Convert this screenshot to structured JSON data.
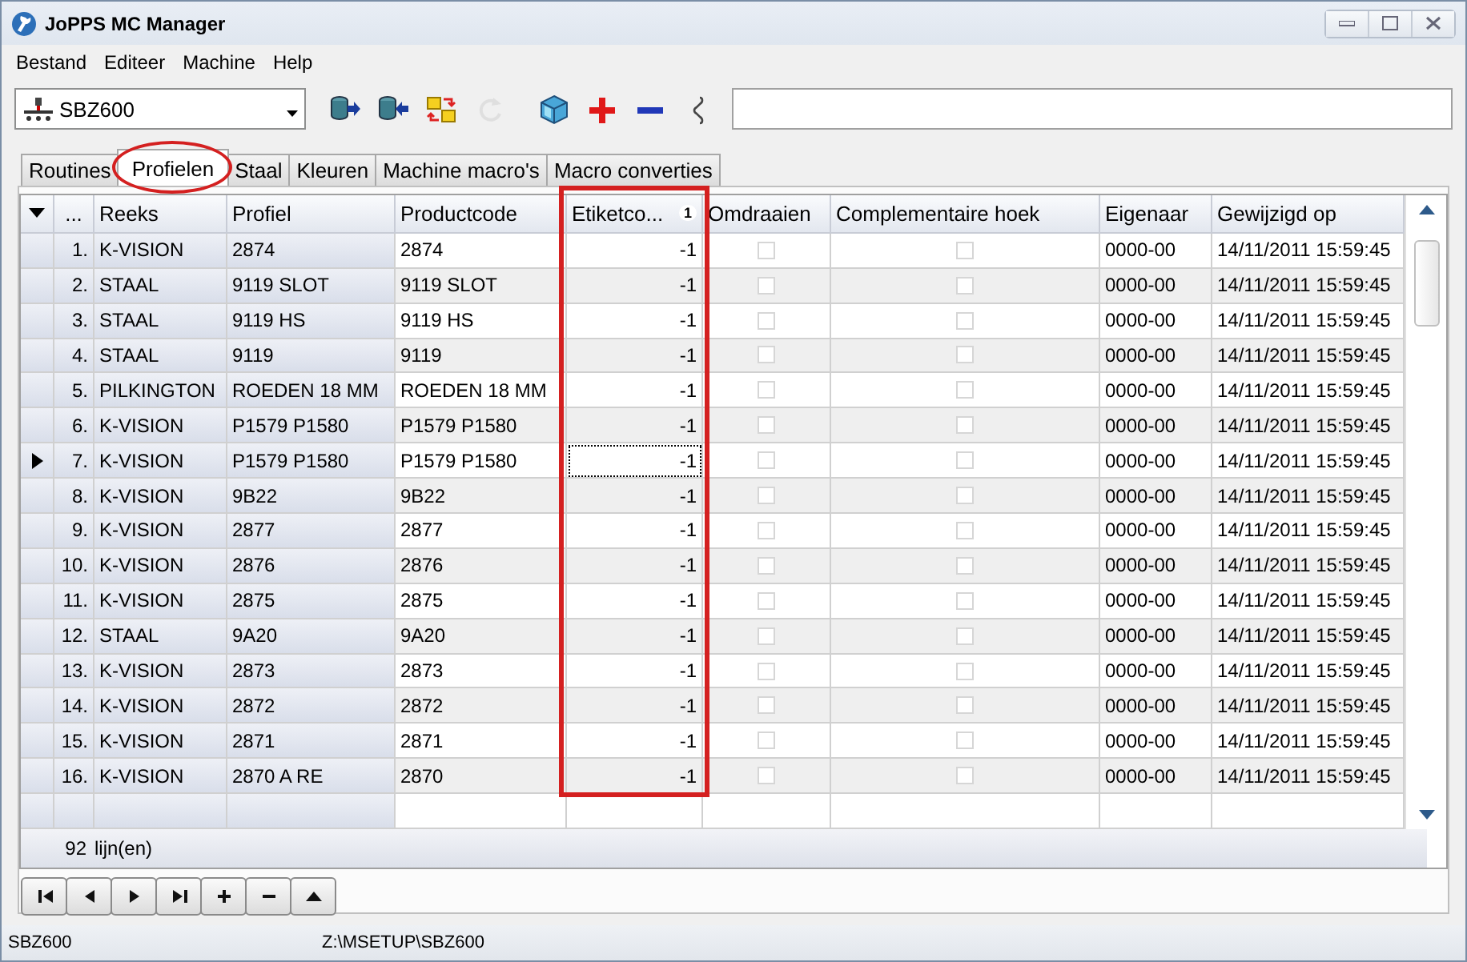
{
  "window": {
    "title": "JoPPS MC Manager"
  },
  "menu": [
    "Bestand",
    "Editeer",
    "Machine",
    "Help"
  ],
  "machine_select": {
    "value": "SBZ600"
  },
  "toolbar": [
    {
      "kind": "db-right",
      "disabled": false
    },
    {
      "kind": "db-left",
      "disabled": false
    },
    {
      "kind": "folders",
      "disabled": false
    },
    {
      "kind": "refresh",
      "disabled": true
    },
    {
      "kind": "cube",
      "disabled": false
    },
    {
      "kind": "plus",
      "disabled": false
    },
    {
      "kind": "minus",
      "disabled": false
    },
    {
      "kind": "link",
      "disabled": false
    }
  ],
  "tabs": [
    {
      "label": "Routines",
      "selected": false,
      "circled": false
    },
    {
      "label": "Profielen",
      "selected": true,
      "circled": true
    },
    {
      "label": "Staal",
      "selected": false,
      "circled": false
    },
    {
      "label": "Kleuren",
      "selected": false,
      "circled": false
    },
    {
      "label": "Machine macro's",
      "selected": false,
      "circled": false
    },
    {
      "label": "Macro converties",
      "selected": false,
      "circled": false
    }
  ],
  "table": {
    "columns": [
      {
        "label": "...",
        "boxed": false
      },
      {
        "label": "Reeks",
        "boxed": false
      },
      {
        "label": "Profiel",
        "boxed": false
      },
      {
        "label": "Productcode",
        "boxed": false
      },
      {
        "label": "Etiketco...",
        "boxed": true,
        "sort_badge": "1"
      },
      {
        "label": "Omdraaien",
        "boxed": false
      },
      {
        "label": "Complementaire hoek",
        "boxed": false
      },
      {
        "label": "Eigenaar",
        "boxed": false
      },
      {
        "label": "Gewijzigd op",
        "boxed": false
      }
    ],
    "rows": [
      {
        "num": "1.",
        "reeks": "K-VISION",
        "profiel": "2874",
        "productcode": "2874",
        "etiketcode": "-1",
        "omdraaien": false,
        "complementaire_hoek": false,
        "eigenaar": "0000-00",
        "gewijzigd_op": "14/11/2011 15:59:45",
        "selected": false
      },
      {
        "num": "2.",
        "reeks": "STAAL",
        "profiel": "9119 SLOT",
        "productcode": "9119 SLOT",
        "etiketcode": "-1",
        "omdraaien": false,
        "complementaire_hoek": false,
        "eigenaar": "0000-00",
        "gewijzigd_op": "14/11/2011 15:59:45",
        "selected": false
      },
      {
        "num": "3.",
        "reeks": "STAAL",
        "profiel": "9119 HS",
        "productcode": "9119 HS",
        "etiketcode": "-1",
        "omdraaien": false,
        "complementaire_hoek": false,
        "eigenaar": "0000-00",
        "gewijzigd_op": "14/11/2011 15:59:45",
        "selected": false
      },
      {
        "num": "4.",
        "reeks": "STAAL",
        "profiel": "9119",
        "productcode": "9119",
        "etiketcode": "-1",
        "omdraaien": false,
        "complementaire_hoek": false,
        "eigenaar": "0000-00",
        "gewijzigd_op": "14/11/2011 15:59:45",
        "selected": false
      },
      {
        "num": "5.",
        "reeks": "PILKINGTON",
        "profiel": "ROEDEN 18 MM",
        "productcode": "ROEDEN 18 MM",
        "etiketcode": "-1",
        "omdraaien": false,
        "complementaire_hoek": false,
        "eigenaar": "0000-00",
        "gewijzigd_op": "14/11/2011 15:59:45",
        "selected": false
      },
      {
        "num": "6.",
        "reeks": "K-VISION",
        "profiel": "P1579 P1580",
        "productcode": "P1579 P1580",
        "etiketcode": "-1",
        "omdraaien": false,
        "complementaire_hoek": false,
        "eigenaar": "0000-00",
        "gewijzigd_op": "14/11/2011 15:59:45",
        "selected": false
      },
      {
        "num": "7.",
        "reeks": "K-VISION",
        "profiel": "P1579 P1580",
        "productcode": "P1579 P1580",
        "etiketcode": "-1",
        "omdraaien": false,
        "complementaire_hoek": false,
        "eigenaar": "0000-00",
        "gewijzigd_op": "14/11/2011 15:59:45",
        "selected": true
      },
      {
        "num": "8.",
        "reeks": "K-VISION",
        "profiel": "9B22",
        "productcode": "9B22",
        "etiketcode": "-1",
        "omdraaien": false,
        "complementaire_hoek": false,
        "eigenaar": "0000-00",
        "gewijzigd_op": "14/11/2011 15:59:45",
        "selected": false
      },
      {
        "num": "9.",
        "reeks": "K-VISION",
        "profiel": "2877",
        "productcode": "2877",
        "etiketcode": "-1",
        "omdraaien": false,
        "complementaire_hoek": false,
        "eigenaar": "0000-00",
        "gewijzigd_op": "14/11/2011 15:59:45",
        "selected": false
      },
      {
        "num": "10.",
        "reeks": "K-VISION",
        "profiel": "2876",
        "productcode": "2876",
        "etiketcode": "-1",
        "omdraaien": false,
        "complementaire_hoek": false,
        "eigenaar": "0000-00",
        "gewijzigd_op": "14/11/2011 15:59:45",
        "selected": false
      },
      {
        "num": "11.",
        "reeks": "K-VISION",
        "profiel": "2875",
        "productcode": "2875",
        "etiketcode": "-1",
        "omdraaien": false,
        "complementaire_hoek": false,
        "eigenaar": "0000-00",
        "gewijzigd_op": "14/11/2011 15:59:45",
        "selected": false
      },
      {
        "num": "12.",
        "reeks": "STAAL",
        "profiel": "9A20",
        "productcode": "9A20",
        "etiketcode": "-1",
        "omdraaien": false,
        "complementaire_hoek": false,
        "eigenaar": "0000-00",
        "gewijzigd_op": "14/11/2011 15:59:45",
        "selected": false
      },
      {
        "num": "13.",
        "reeks": "K-VISION",
        "profiel": "2873",
        "productcode": "2873",
        "etiketcode": "-1",
        "omdraaien": false,
        "complementaire_hoek": false,
        "eigenaar": "0000-00",
        "gewijzigd_op": "14/11/2011 15:59:45",
        "selected": false
      },
      {
        "num": "14.",
        "reeks": "K-VISION",
        "profiel": "2872",
        "productcode": "2872",
        "etiketcode": "-1",
        "omdraaien": false,
        "complementaire_hoek": false,
        "eigenaar": "0000-00",
        "gewijzigd_op": "14/11/2011 15:59:45",
        "selected": false
      },
      {
        "num": "15.",
        "reeks": "K-VISION",
        "profiel": "2871",
        "productcode": "2871",
        "etiketcode": "-1",
        "omdraaien": false,
        "complementaire_hoek": false,
        "eigenaar": "0000-00",
        "gewijzigd_op": "14/11/2011 15:59:45",
        "selected": false
      },
      {
        "num": "16.",
        "reeks": "K-VISION",
        "profiel": "2870 A RE",
        "productcode": "2870",
        "etiketcode": "-1",
        "omdraaien": false,
        "complementaire_hoek": false,
        "eigenaar": "0000-00",
        "gewijzigd_op": "14/11/2011 15:59:45",
        "selected": false
      }
    ],
    "footer": {
      "count": "92",
      "label": "lijn(en)"
    }
  },
  "navigator": [
    {
      "kind": "first"
    },
    {
      "kind": "prev"
    },
    {
      "kind": "next"
    },
    {
      "kind": "last"
    },
    {
      "kind": "add"
    },
    {
      "kind": "remove"
    },
    {
      "kind": "up"
    }
  ],
  "status_bar": [
    "SBZ600",
    "Z:\\MSETUP\\SBZ600"
  ]
}
